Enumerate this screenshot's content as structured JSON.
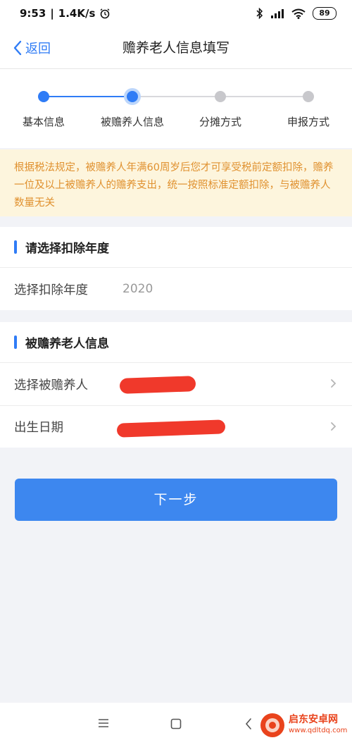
{
  "status_bar": {
    "time": "9:53",
    "speed": "1.4K/s",
    "battery": "89"
  },
  "nav": {
    "back_label": "返回",
    "title": "赡养老人信息填写"
  },
  "stepper": {
    "steps": [
      {
        "label": "基本信息",
        "state": "done"
      },
      {
        "label": "被赡养人信息",
        "state": "current"
      },
      {
        "label": "分摊方式",
        "state": "pending"
      },
      {
        "label": "申报方式",
        "state": "pending"
      }
    ],
    "colors": {
      "active": "#2f7cf6",
      "pending": "#c8c8cc"
    }
  },
  "notice": {
    "text": "根据税法规定，被赡养人年满60周岁后您才可享受税前定额扣除，赡养一位及以上被赡养人的赡养支出，统一按照标准定额扣除，与被赡养人数量无关"
  },
  "section_year": {
    "title": "请选择扣除年度",
    "row_label": "选择扣除年度",
    "row_value": "2020"
  },
  "section_person": {
    "title": "被赡养老人信息",
    "rows": [
      {
        "label": "选择被赡养人"
      },
      {
        "label": "出生日期"
      }
    ]
  },
  "next_button": {
    "label": "下一步"
  },
  "watermark": {
    "name": "启东安卓网",
    "url": "www.qdltdq.com"
  },
  "icons": {
    "back": "chevron-left-icon",
    "row_arrow": "chevron-right-icon",
    "sys_menu": "menu-icon",
    "sys_home": "home-square-icon",
    "sys_back": "back-arrow-icon"
  }
}
